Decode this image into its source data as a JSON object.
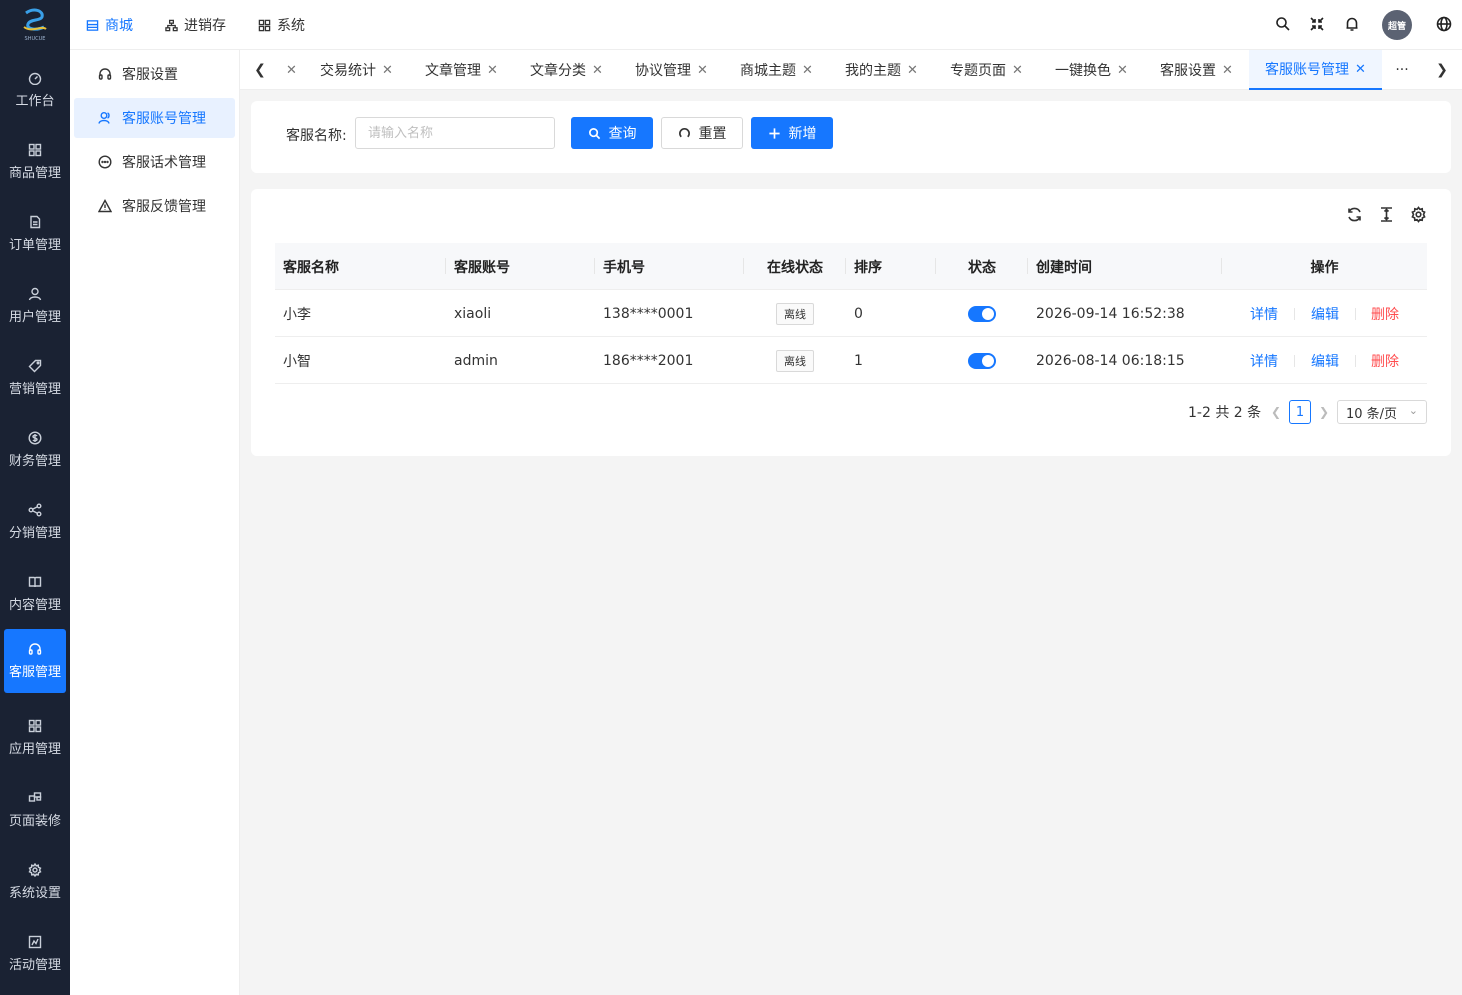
{
  "brand": {
    "logo_text": "SHUCUE"
  },
  "rail": [
    {
      "label": "工作台",
      "icon": "dashboard-icon"
    },
    {
      "label": "商品管理",
      "icon": "grid-icon"
    },
    {
      "label": "订单管理",
      "icon": "document-icon"
    },
    {
      "label": "用户管理",
      "icon": "user-icon"
    },
    {
      "label": "营销管理",
      "icon": "tag-icon"
    },
    {
      "label": "财务管理",
      "icon": "dollar-icon"
    },
    {
      "label": "分销管理",
      "icon": "share-icon"
    },
    {
      "label": "内容管理",
      "icon": "book-icon"
    },
    {
      "label": "客服管理",
      "icon": "headset-icon",
      "active": true
    },
    {
      "label": "应用管理",
      "icon": "apps-icon"
    },
    {
      "label": "页面装修",
      "icon": "layout-icon"
    },
    {
      "label": "系统设置",
      "icon": "gear-icon"
    },
    {
      "label": "活动管理",
      "icon": "activity-icon"
    }
  ],
  "topnav": [
    {
      "label": "商城",
      "active": true
    },
    {
      "label": "进销存"
    },
    {
      "label": "系统"
    }
  ],
  "user": {
    "avatar_text": "超管"
  },
  "subnav": [
    {
      "label": "客服设置",
      "icon": "headset-icon"
    },
    {
      "label": "客服账号管理",
      "icon": "users-icon",
      "active": true
    },
    {
      "label": "客服话术管理",
      "icon": "chat-icon"
    },
    {
      "label": "客服反馈管理",
      "icon": "warning-icon"
    }
  ],
  "tabs": [
    {
      "label": "交易统计"
    },
    {
      "label": "文章管理"
    },
    {
      "label": "文章分类"
    },
    {
      "label": "协议管理"
    },
    {
      "label": "商城主题"
    },
    {
      "label": "我的主题"
    },
    {
      "label": "专题页面"
    },
    {
      "label": "一键换色"
    },
    {
      "label": "客服设置"
    },
    {
      "label": "客服账号管理",
      "active": true
    }
  ],
  "tabs_more": "···",
  "search": {
    "label": "客服名称:",
    "placeholder": "请输入名称",
    "query_label": "查询",
    "reset_label": "重置",
    "add_label": "新增"
  },
  "table": {
    "columns": [
      "客服名称",
      "客服账号",
      "手机号",
      "在线状态",
      "排序",
      "状态",
      "创建时间",
      "操作"
    ],
    "rows": [
      {
        "name": "小李",
        "account": "xiaoli",
        "phone": "138****0001",
        "online": "离线",
        "sort": "0",
        "status_on": true,
        "created": "2026-09-14 16:52:38"
      },
      {
        "name": "小智",
        "account": "admin",
        "phone": "186****2001",
        "online": "离线",
        "sort": "1",
        "status_on": true,
        "created": "2026-08-14 06:18:15"
      }
    ],
    "actions": {
      "detail": "详情",
      "edit": "编辑",
      "delete": "删除"
    }
  },
  "pagination": {
    "summary": "1-2 共 2 条",
    "current": "1",
    "page_size": "10 条/页"
  },
  "colors": {
    "primary": "#1677ff",
    "danger": "#ff4d4f",
    "sidebar": "#1a2233"
  }
}
